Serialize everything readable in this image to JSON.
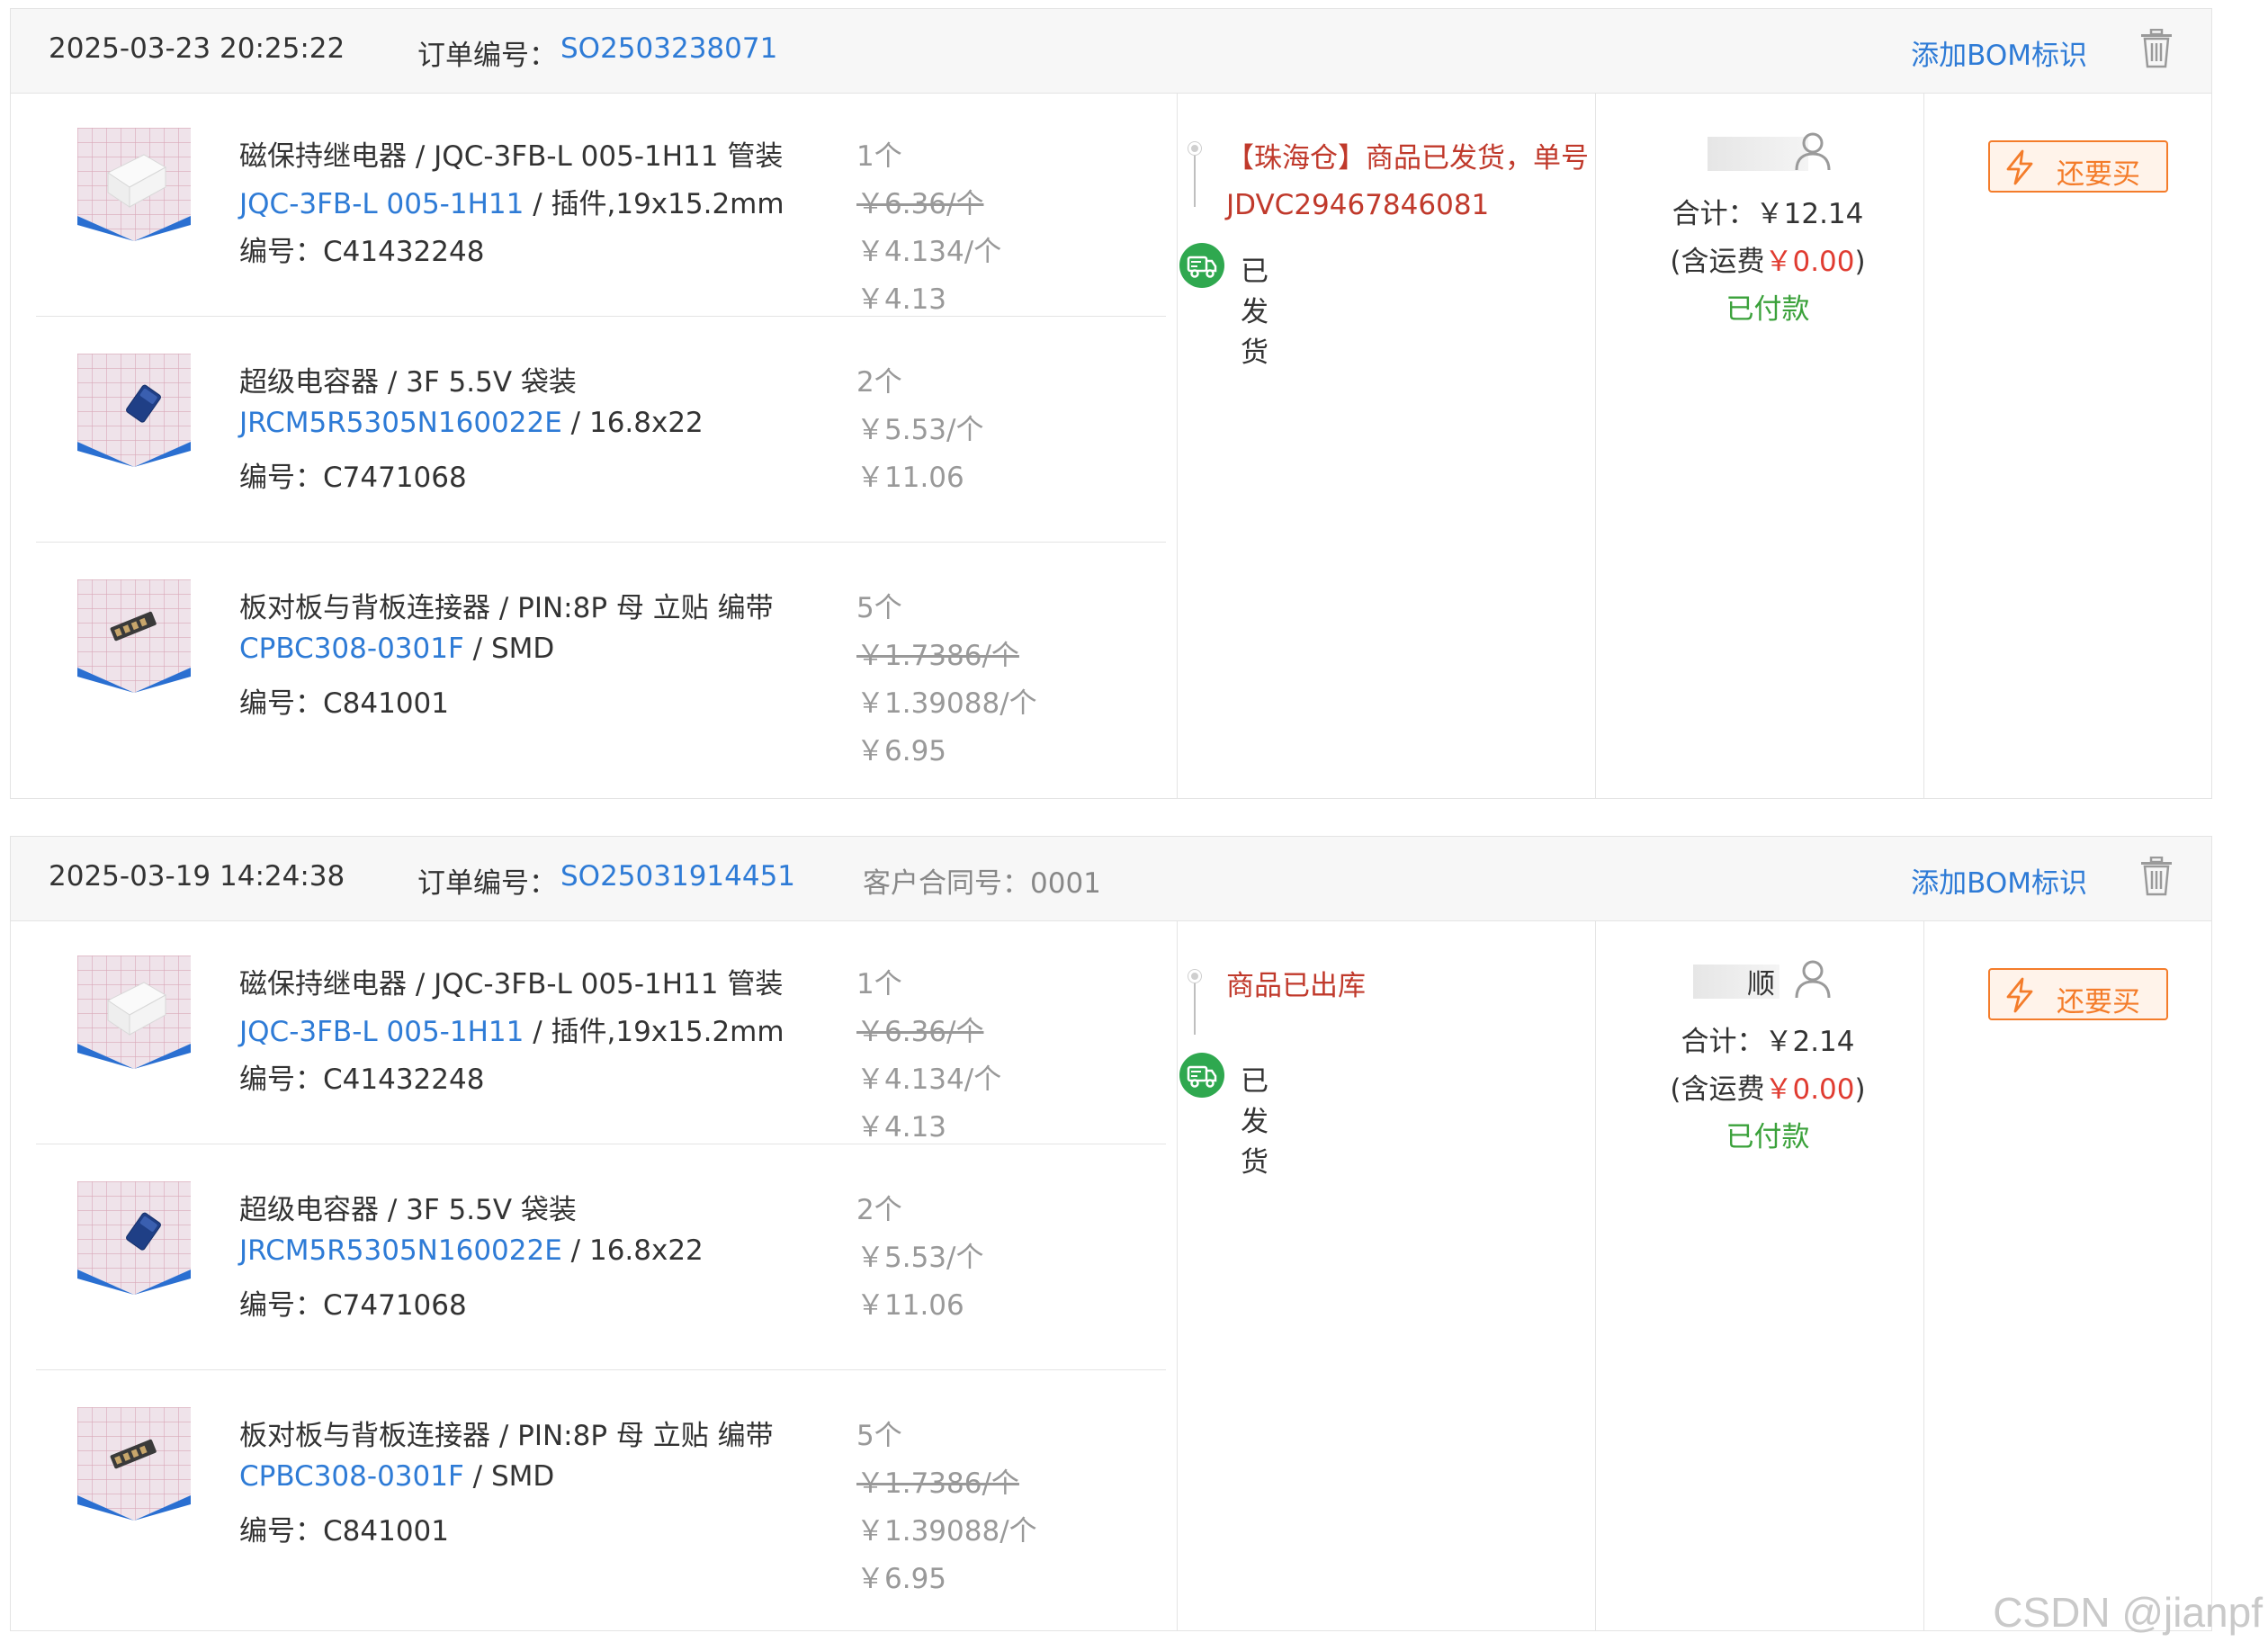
{
  "orders": [
    {
      "datetime": "2025-03-23 20:25:22",
      "order_no_label": "订单编号：",
      "order_no": "SO2503238071",
      "contract": "",
      "add_bom": "添加BOM标识",
      "items": [
        {
          "name": "磁保持继电器 / JQC-3FB-L 005-1H11 管装",
          "model_link": "JQC-3FB-L 005-1H11",
          "model_rest": " / 插件,19x15.2mm",
          "code": "编号：C41432248",
          "qty": "1个",
          "orig_price": "￥6.36/个",
          "unit_price": "￥4.134/个",
          "subtotal": "￥4.13"
        },
        {
          "name": "超级电容器 / 3F 5.5V 袋装",
          "model_link": "JRCM5R5305N160022E",
          "model_rest": " / 16.8x22",
          "code": "编号：C7471068",
          "qty": "2个",
          "orig_price": "",
          "unit_price": "￥5.53/个",
          "subtotal": "￥11.06"
        },
        {
          "name": "板对板与背板连接器 / PIN:8P 母 立贴 编带",
          "model_link": "CPBC308-0301F",
          "model_rest": " / SMD",
          "code": "编号：C841001",
          "qty": "5个",
          "orig_price": "￥1.7386/个",
          "unit_price": "￥1.39088/个",
          "subtotal": "￥6.95"
        }
      ],
      "shipping": {
        "message": "【珠海仓】商品已发货，单号JDVC29467846081",
        "status": "已发货"
      },
      "payment": {
        "user_name": "",
        "total": "合计：￥12.14",
        "fee_prefix": "(含运费",
        "fee_value": "￥0.00",
        "fee_suffix": ")",
        "status": "已付款"
      },
      "rebuy": "还要买"
    },
    {
      "datetime": "2025-03-19 14:24:38",
      "order_no_label": "订单编号：",
      "order_no": "SO25031914451",
      "contract": "客户合同号：0001",
      "add_bom": "添加BOM标识",
      "items": [
        {
          "name": "磁保持继电器 / JQC-3FB-L 005-1H11 管装",
          "model_link": "JQC-3FB-L 005-1H11",
          "model_rest": " / 插件,19x15.2mm",
          "code": "编号：C41432248",
          "qty": "1个",
          "orig_price": "￥6.36/个",
          "unit_price": "￥4.134/个",
          "subtotal": "￥4.13"
        },
        {
          "name": "超级电容器 / 3F 5.5V 袋装",
          "model_link": "JRCM5R5305N160022E",
          "model_rest": " / 16.8x22",
          "code": "编号：C7471068",
          "qty": "2个",
          "orig_price": "",
          "unit_price": "￥5.53/个",
          "subtotal": "￥11.06"
        },
        {
          "name": "板对板与背板连接器 / PIN:8P 母 立贴 编带",
          "model_link": "CPBC308-0301F",
          "model_rest": " / SMD",
          "code": "编号：C841001",
          "qty": "5个",
          "orig_price": "￥1.7386/个",
          "unit_price": "￥1.39088/个",
          "subtotal": "￥6.95"
        }
      ],
      "shipping": {
        "message": "商品已出库",
        "status": "已发货"
      },
      "payment": {
        "user_name": "顺",
        "total": "合计：￥2.14",
        "fee_prefix": "(含运费",
        "fee_value": "￥0.00",
        "fee_suffix": ")",
        "status": "已付款"
      },
      "rebuy": "还要买"
    }
  ],
  "watermark": "CSDN @jianpf",
  "icons": {
    "trash": "trash-icon",
    "user": "user-icon",
    "truck": "truck-icon",
    "bolt": "lightning-icon",
    "thumbs": [
      "relay-thumbnail",
      "capacitor-thumbnail",
      "connector-thumbnail"
    ]
  },
  "colors": {
    "link": "#2e7bd6",
    "price_red": "#e03c31",
    "paid_green": "#3aa13a",
    "rebuy_orange": "#f47c2a",
    "ship_msg": "#c0392b"
  }
}
